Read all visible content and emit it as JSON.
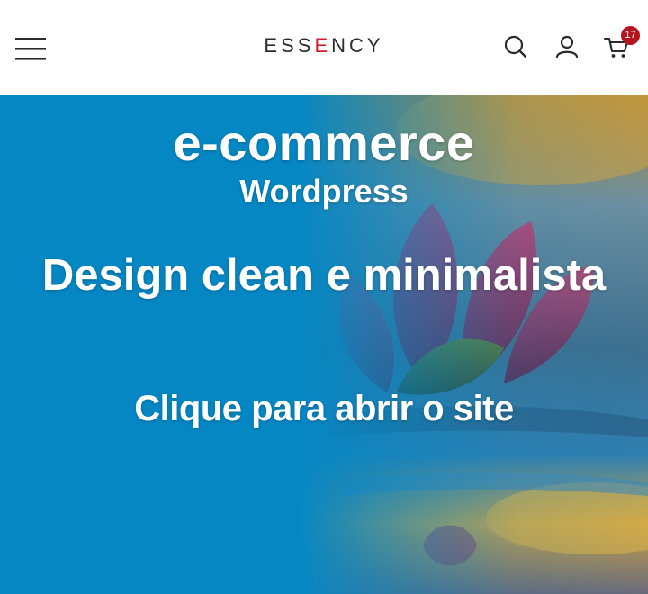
{
  "header": {
    "logo_prefix": "ESS",
    "logo_accent": "E",
    "logo_suffix": "NCY",
    "cart_count": "17",
    "icons": [
      "hamburger-menu-icon",
      "search-icon",
      "user-icon",
      "cart-icon"
    ]
  },
  "hero": {
    "title": "e-commerce",
    "subtitle": "Wordpress",
    "tagline": "Design clean e minimalista",
    "cta": "Clique para abrir o site"
  },
  "colors": {
    "accent": "#d01f2f",
    "badge": "#b4141d",
    "hero_blue": "#0587c4",
    "text_dark": "#2b2b2b"
  }
}
